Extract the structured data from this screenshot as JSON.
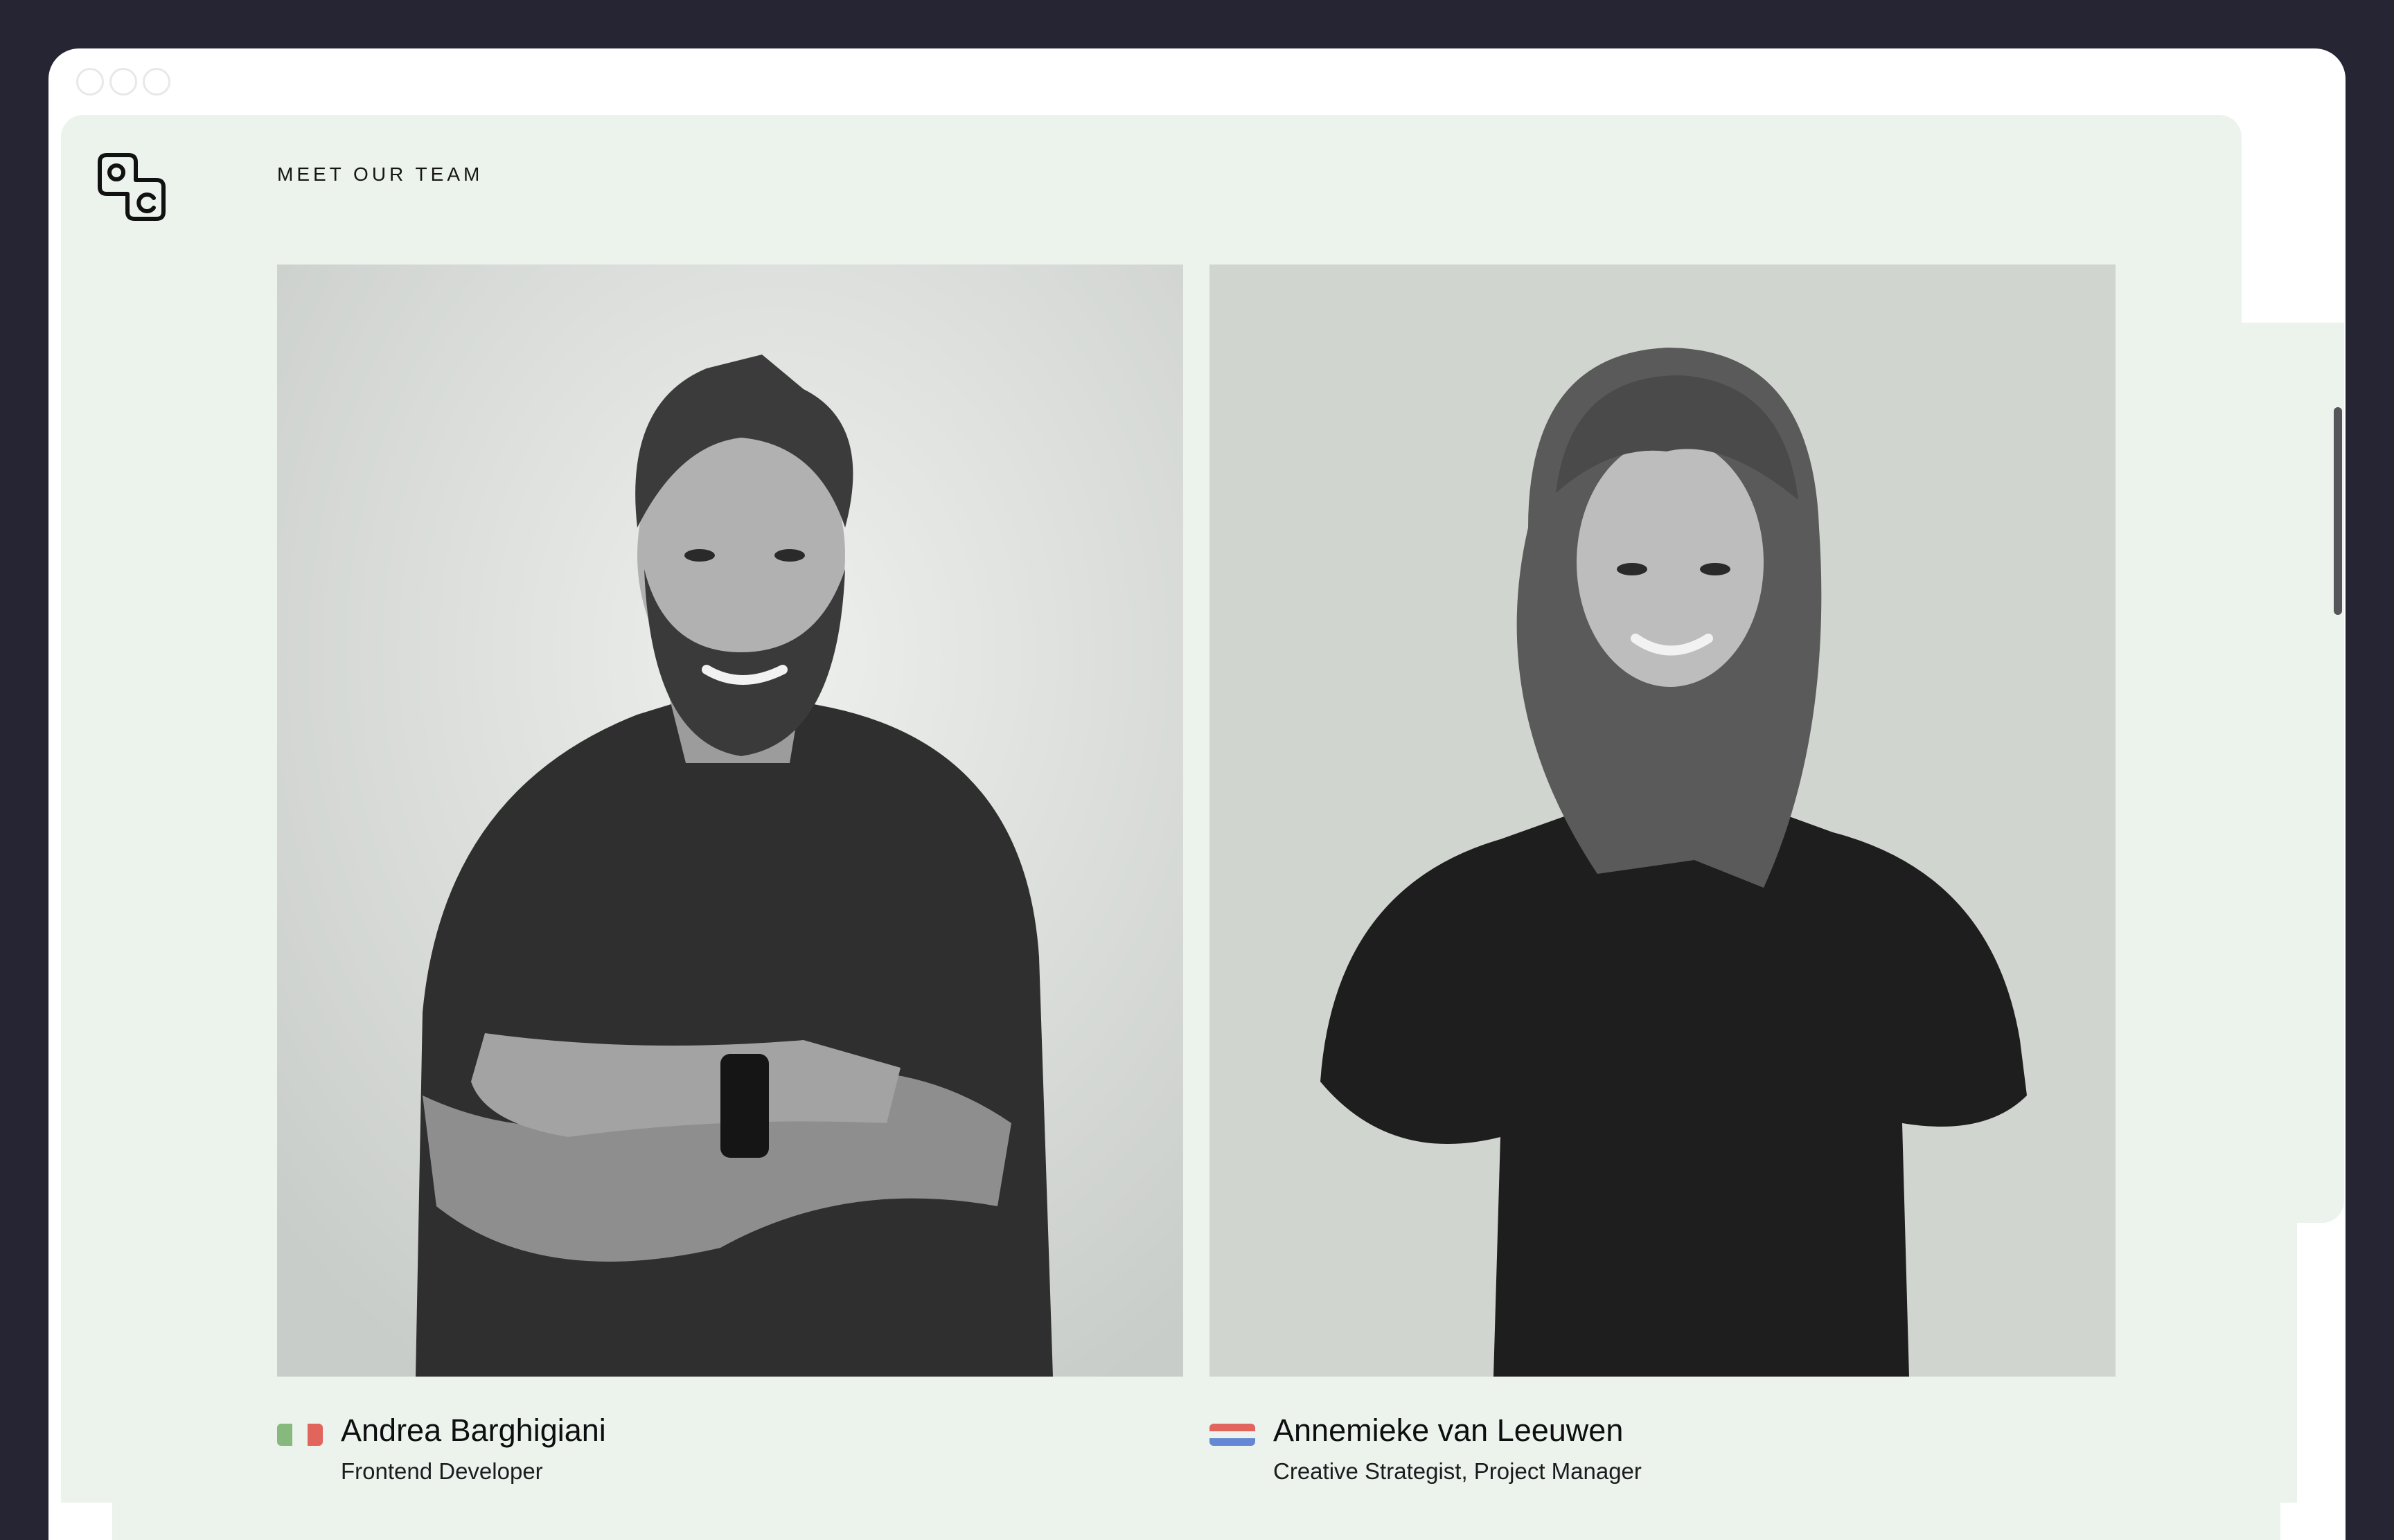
{
  "page": {
    "heading": "MEET OUR TEAM",
    "logo_icon": "studio-logo-icon"
  },
  "colors": {
    "background": "#262534",
    "window": "#ffffff",
    "page_mint": "#ecf2ec",
    "text": "#0e0e10"
  },
  "team": [
    {
      "name": "Andrea Barghigiani",
      "role": "Frontend Developer",
      "flag_icon": "italy-flag-icon",
      "flag_colors": [
        "#86b97d",
        "#ecf2ec",
        "#e1655d"
      ]
    },
    {
      "name": "Annemieke van Leeuwen",
      "role": "Creative Strategist, Project Manager",
      "flag_icon": "netherlands-flag-icon",
      "flag_colors": [
        "#e1655d",
        "#ecf2ec",
        "#6688d4"
      ]
    }
  ]
}
